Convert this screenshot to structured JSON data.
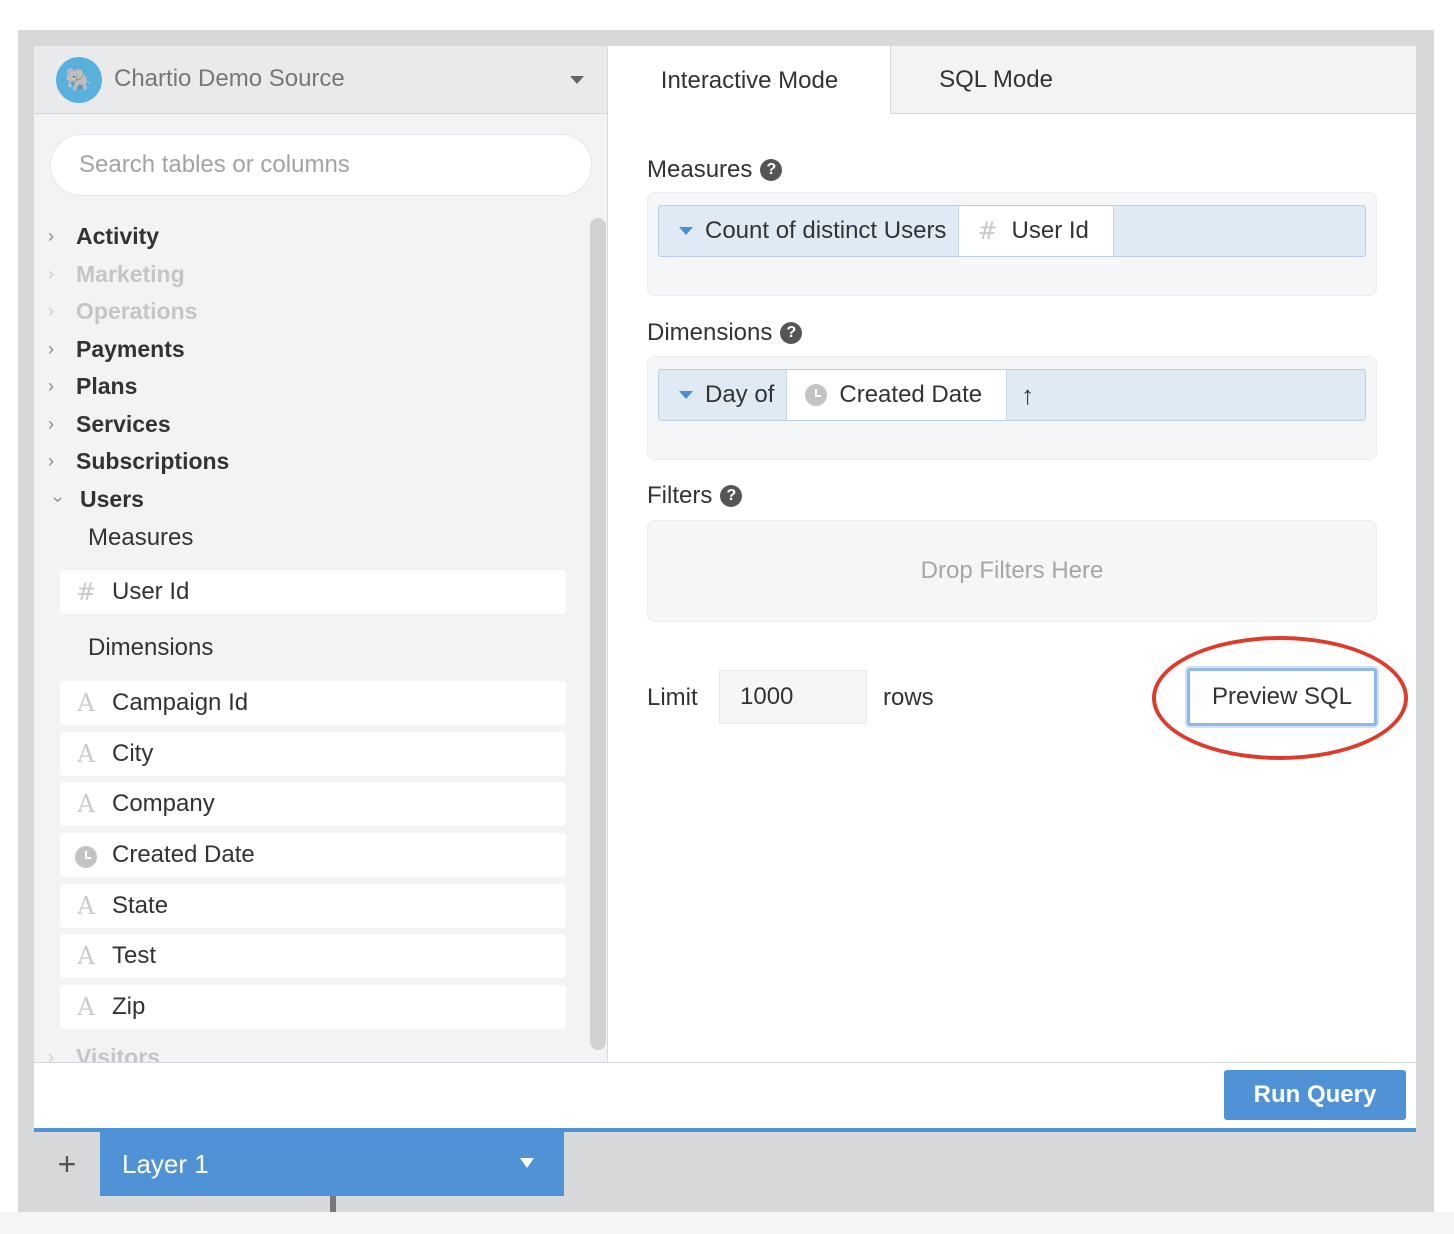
{
  "source": {
    "name": "Chartio Demo Source"
  },
  "search": {
    "placeholder": "Search tables or columns"
  },
  "tree": {
    "items": [
      {
        "label": "Activity",
        "enabled": true,
        "expanded": false
      },
      {
        "label": "Marketing",
        "enabled": false,
        "expanded": false
      },
      {
        "label": "Operations",
        "enabled": false,
        "expanded": false
      },
      {
        "label": "Payments",
        "enabled": true,
        "expanded": false
      },
      {
        "label": "Plans",
        "enabled": true,
        "expanded": false
      },
      {
        "label": "Services",
        "enabled": true,
        "expanded": false
      },
      {
        "label": "Subscriptions",
        "enabled": true,
        "expanded": false
      },
      {
        "label": "Users",
        "enabled": true,
        "expanded": true
      },
      {
        "label": "Visitors",
        "enabled": false,
        "expanded": false
      }
    ],
    "users": {
      "measures_label": "Measures",
      "dimensions_label": "Dimensions",
      "measures": [
        {
          "label": "User Id",
          "icon": "hash-icon"
        }
      ],
      "dimensions": [
        {
          "label": "Campaign Id",
          "icon": "text-type-icon"
        },
        {
          "label": "City",
          "icon": "text-type-icon"
        },
        {
          "label": "Company",
          "icon": "text-type-icon"
        },
        {
          "label": "Created Date",
          "icon": "clock-icon"
        },
        {
          "label": "State",
          "icon": "text-type-icon"
        },
        {
          "label": "Test",
          "icon": "text-type-icon"
        },
        {
          "label": "Zip",
          "icon": "text-type-icon"
        }
      ]
    }
  },
  "tabs": {
    "interactive": "Interactive Mode",
    "sql": "SQL Mode"
  },
  "builder": {
    "measures_label": "Measures",
    "measure_pill": {
      "aggregate": "Count of distinct Users",
      "field": "User Id"
    },
    "dimensions_label": "Dimensions",
    "dimension_pill": {
      "granularity": "Day of",
      "field": "Created Date",
      "sort": "↑"
    },
    "filters_label": "Filters",
    "filters_placeholder": "Drop Filters Here",
    "limit_label": "Limit",
    "limit_value": "1000",
    "rows_label": "rows",
    "preview_sql": "Preview SQL",
    "run_query": "Run Query"
  },
  "layers": {
    "add": "+",
    "active": "Layer 1"
  },
  "colors": {
    "accent": "#4f93d6",
    "highlight": "#dd3b2c"
  }
}
